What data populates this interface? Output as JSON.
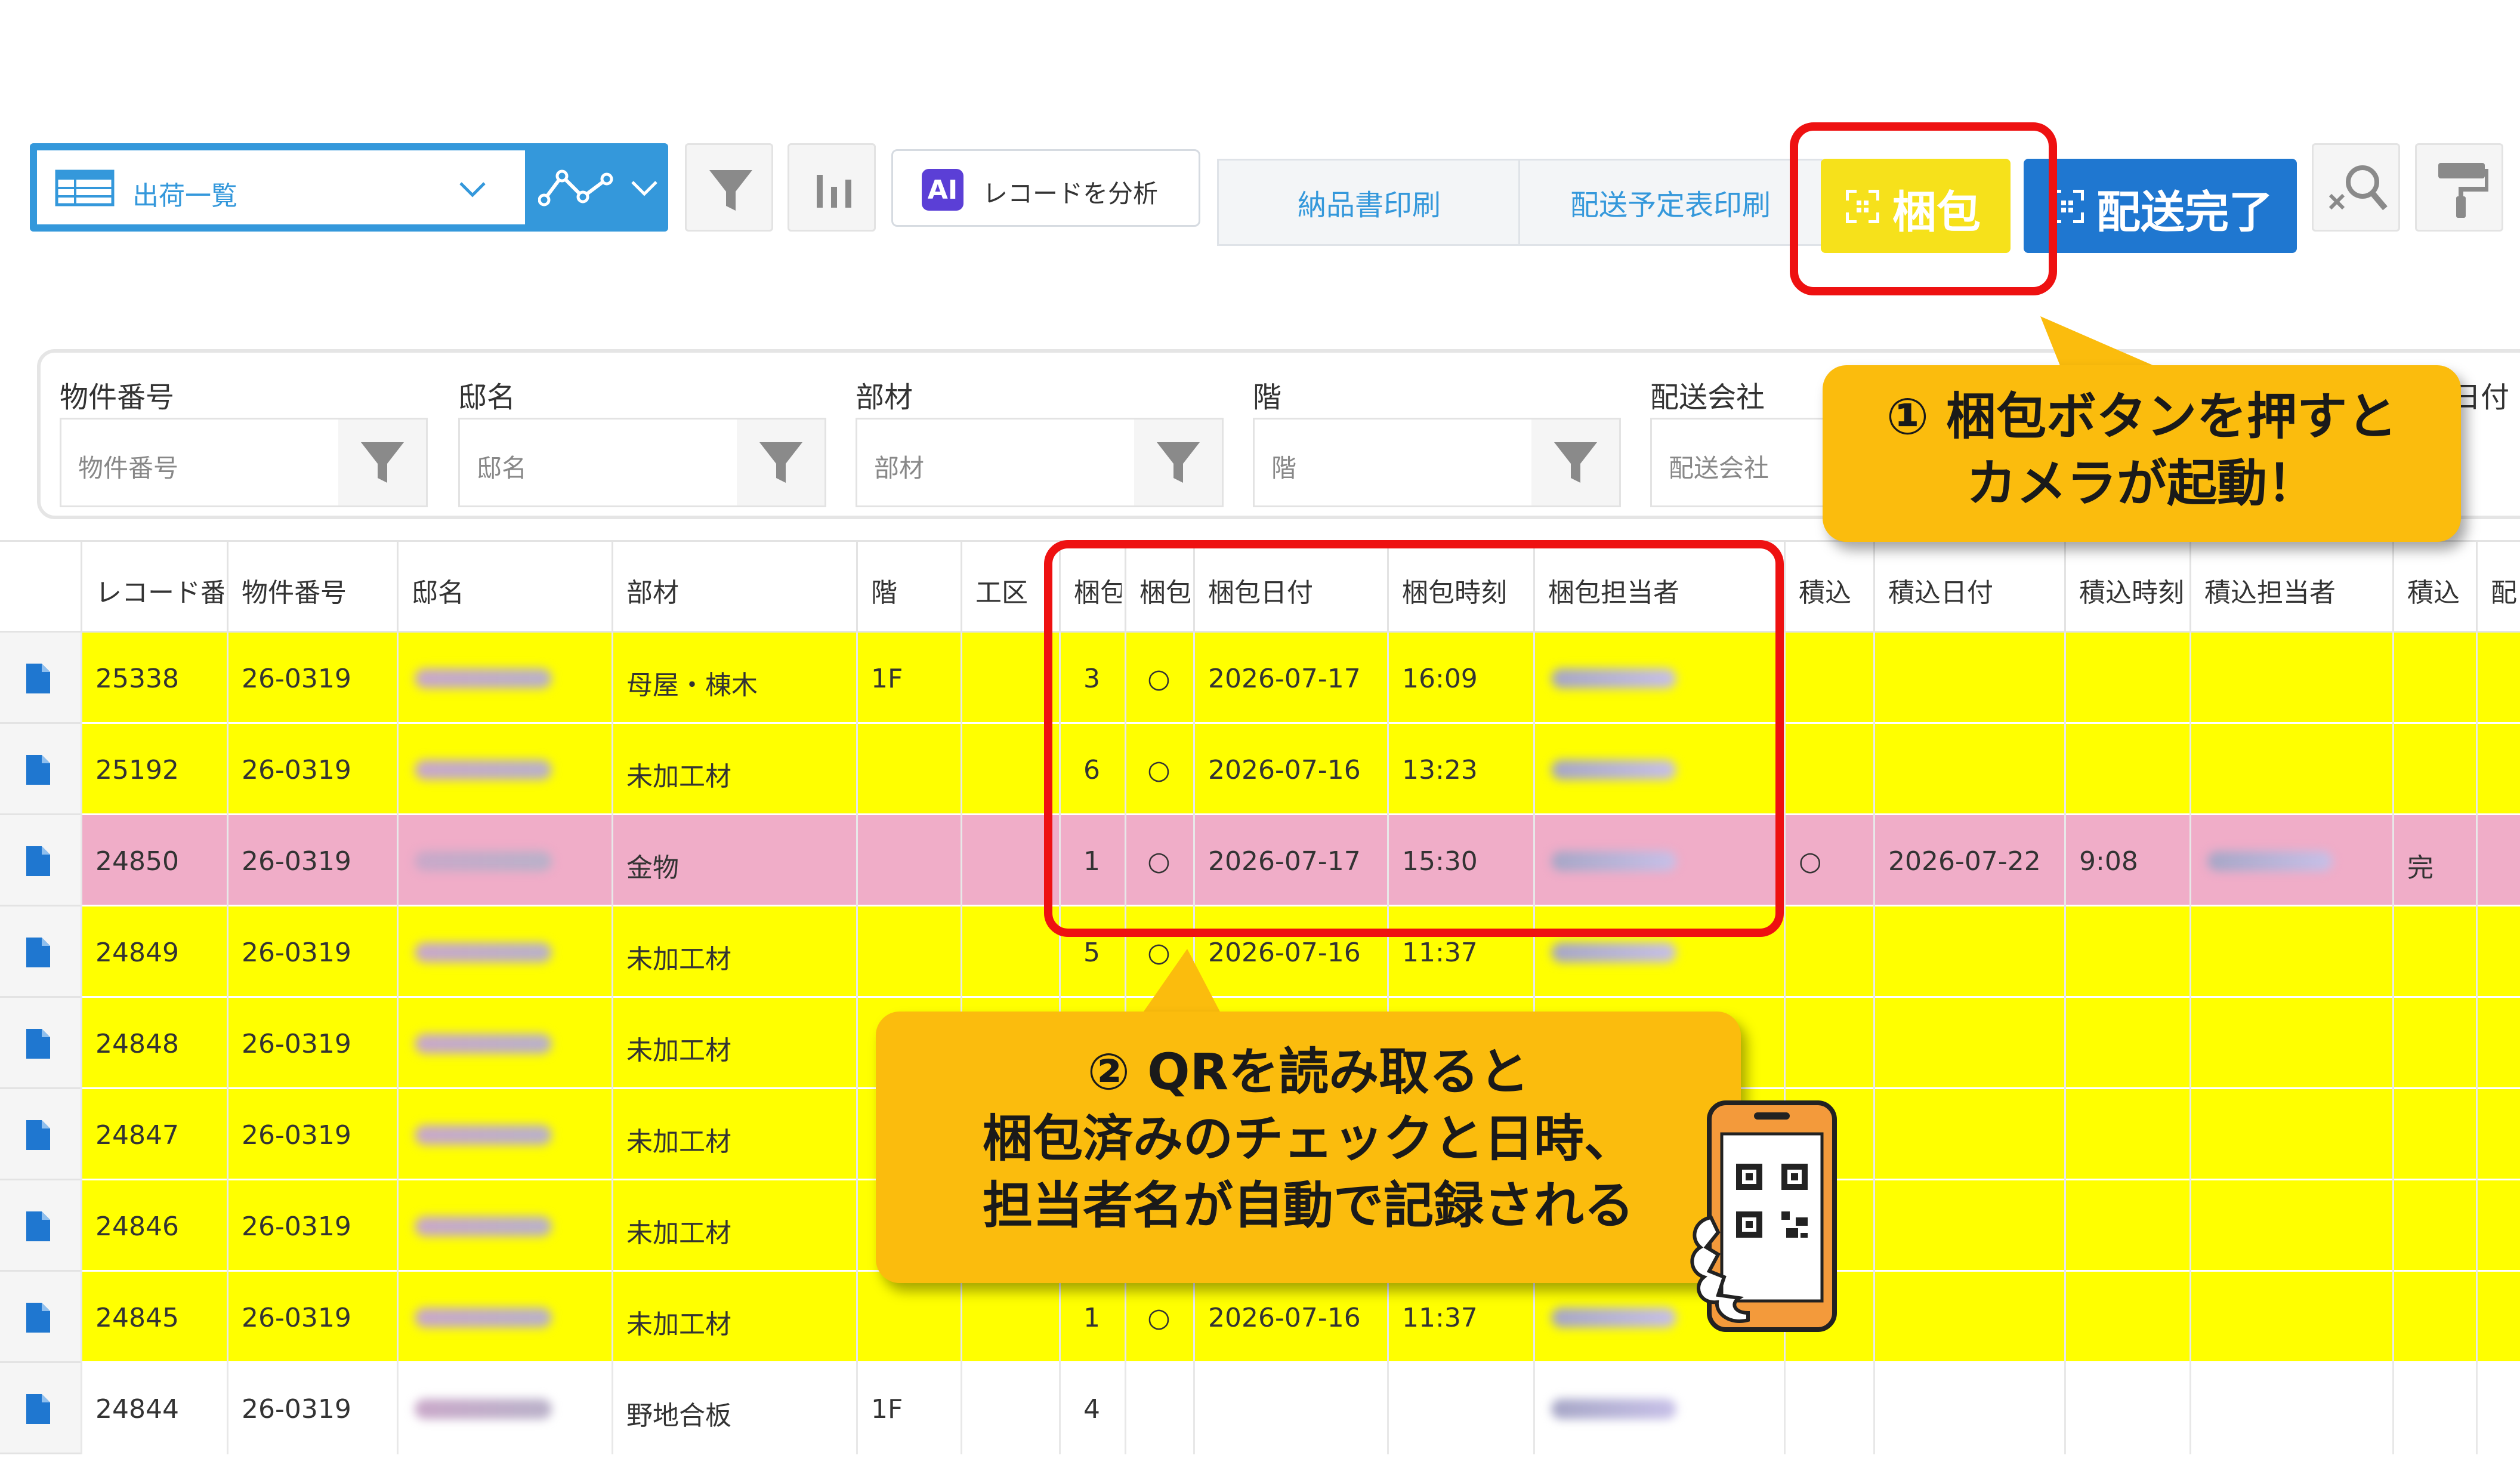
{
  "toolbar": {
    "view_name": "出荷一覧",
    "ai_label": "AI",
    "analyze_label": "レコードを分析",
    "print_delivery_note": "納品書印刷",
    "print_schedule": "配送予定表印刷",
    "pack_button": "梱包",
    "delivery_done_button": "配送完了"
  },
  "filters": [
    {
      "label": "物件番号",
      "placeholder": "物件番号"
    },
    {
      "label": "邸名",
      "placeholder": "邸名"
    },
    {
      "label": "部材",
      "placeholder": "部材"
    },
    {
      "label": "階",
      "placeholder": "階"
    },
    {
      "label": "配送会社",
      "placeholder": "配送会社"
    },
    {
      "label": "日付",
      "placeholder": ""
    }
  ],
  "table": {
    "headers": [
      "レコード番号",
      "物件番号",
      "邸名",
      "部材",
      "階",
      "工区",
      "梱包",
      "梱包",
      "梱包日付",
      "梱包時刻",
      "梱包担当者",
      "積込",
      "積込日付",
      "積込時刻",
      "積込担当者",
      "積込",
      "配送"
    ],
    "rows": [
      {
        "id": "25338",
        "prop": "26-0319",
        "part": "母屋・棟木",
        "floor": "1F",
        "qty": "3",
        "mark": "○",
        "date": "2026-07-17",
        "time": "16:09",
        "lmark": "",
        "ldate": "",
        "ltime": "",
        "ldone": "",
        "bg": "yellow"
      },
      {
        "id": "25192",
        "prop": "26-0319",
        "part": "未加工材",
        "floor": "",
        "qty": "6",
        "mark": "○",
        "date": "2026-07-16",
        "time": "13:23",
        "lmark": "",
        "ldate": "",
        "ltime": "",
        "ldone": "",
        "bg": "yellow"
      },
      {
        "id": "24850",
        "prop": "26-0319",
        "part": "金物",
        "floor": "",
        "qty": "1",
        "mark": "○",
        "date": "2026-07-17",
        "time": "15:30",
        "lmark": "○",
        "ldate": "2026-07-22",
        "ltime": "9:08",
        "ldone": "完",
        "bg": "pink"
      },
      {
        "id": "24849",
        "prop": "26-0319",
        "part": "未加工材",
        "floor": "",
        "qty": "5",
        "mark": "○",
        "date": "2026-07-16",
        "time": "11:37",
        "lmark": "",
        "ldate": "",
        "ltime": "",
        "ldone": "",
        "bg": "yellow"
      },
      {
        "id": "24848",
        "prop": "26-0319",
        "part": "未加工材",
        "floor": "",
        "qty": "",
        "mark": "",
        "date": "",
        "time": "",
        "lmark": "",
        "ldate": "",
        "ltime": "",
        "ldone": "",
        "bg": "yellow"
      },
      {
        "id": "24847",
        "prop": "26-0319",
        "part": "未加工材",
        "floor": "",
        "qty": "",
        "mark": "",
        "date": "",
        "time": "",
        "lmark": "",
        "ldate": "",
        "ltime": "",
        "ldone": "",
        "bg": "yellow"
      },
      {
        "id": "24846",
        "prop": "26-0319",
        "part": "未加工材",
        "floor": "",
        "qty": "",
        "mark": "",
        "date": "",
        "time": "",
        "lmark": "",
        "ldate": "",
        "ltime": "",
        "ldone": "",
        "bg": "yellow"
      },
      {
        "id": "24845",
        "prop": "26-0319",
        "part": "未加工材",
        "floor": "",
        "qty": "1",
        "mark": "○",
        "date": "2026-07-16",
        "time": "11:37",
        "lmark": "",
        "ldate": "",
        "ltime": "",
        "ldone": "",
        "bg": "yellow"
      },
      {
        "id": "24844",
        "prop": "26-0319",
        "part": "野地合板",
        "floor": "1F",
        "qty": "4",
        "mark": "",
        "date": "",
        "time": "",
        "lmark": "",
        "ldate": "",
        "ltime": "",
        "ldone": "",
        "bg": "white"
      }
    ]
  },
  "callouts": {
    "one_line1": "① 梱包ボタンを押すと",
    "one_line2": "カメラが起動！",
    "two_line1": "② QRを読み取ると",
    "two_line2": "梱包済みのチェックと日時、",
    "two_line3": "担当者名が自動で記録される"
  },
  "colors": {
    "accent": "#3498db",
    "pack_yellow": "#f6e11b",
    "done_blue": "#1f77d0",
    "row_yellow": "#ffff00",
    "row_pink": "#f0adc8",
    "callout": "#fbbc0d",
    "highlight_red": "#ee1111"
  }
}
